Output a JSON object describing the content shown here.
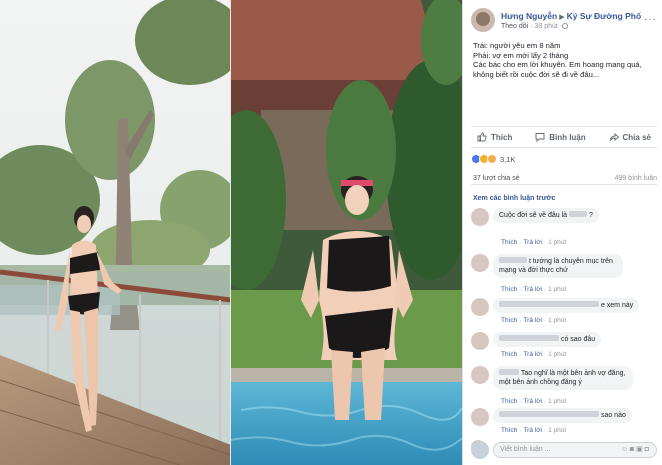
{
  "post": {
    "author": "Hưng Nguyễn",
    "group": "Ký Sự Đường Phố",
    "follow_label": "Theo dõi",
    "time": "38 phút",
    "text_lines": [
      "Trái: người yêu em 8 năm",
      "Phải: vợ em mới lấy 2 tháng",
      "Các bác cho em lời khuyên. Em hoang mang quá,",
      "không biết rồi cuộc đời sẽ đi về đâu..."
    ]
  },
  "actions": {
    "like": "Thích",
    "comment": "Bình luận",
    "share": "Chia sẻ"
  },
  "stats": {
    "reaction_count": "3,1K",
    "shares": "37 lượt chia sẻ",
    "comments": "499 bình luận"
  },
  "comments": {
    "view_previous": "Xem các bình luận trước",
    "like_label": "Thích",
    "reply_label": "Trả lời",
    "items": [
      {
        "text": "Cuộc đời sẽ về đâu là",
        "suffix": "?",
        "time": "1 phút"
      },
      {
        "text": "t tưởng là chuyên mục trên mạng và đời thực chứ",
        "time": "1 phút"
      },
      {
        "text": "e xem này",
        "time": "1 phút"
      },
      {
        "text": "có sao đâu",
        "time": "1 phút"
      },
      {
        "text": "Tao nghĩ là một bên ảnh vợ đăng, một bên ảnh chồng đăng ý",
        "time": "1 phút"
      },
      {
        "text": "sao nào",
        "time": "1 phút"
      },
      {
        "text": "",
        "time": ""
      }
    ]
  },
  "write_comment": {
    "placeholder": "Viết bình luận ..."
  },
  "colors": {
    "link": "#385898",
    "muted": "#90949c",
    "like_blue": "#4a76e8"
  }
}
